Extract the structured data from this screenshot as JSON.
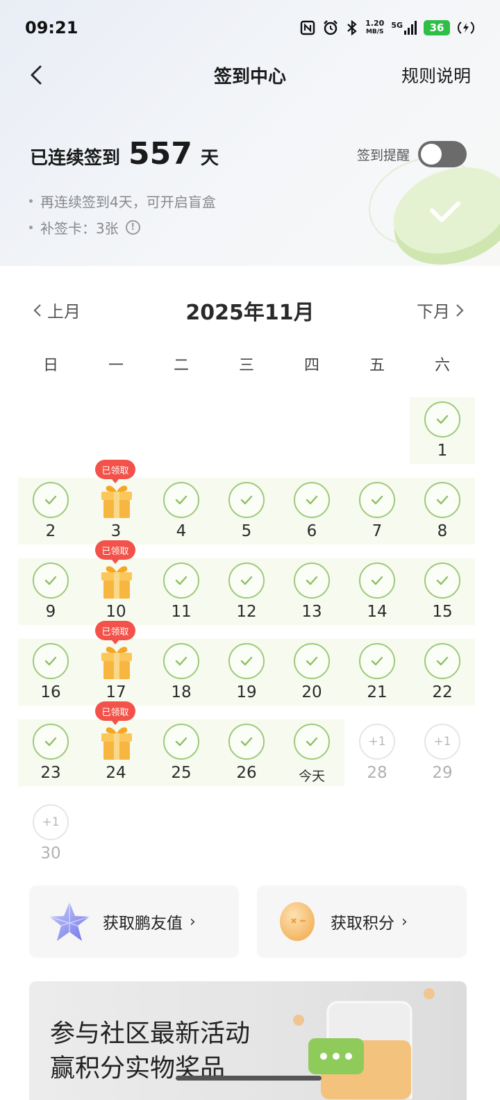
{
  "status_bar": {
    "time": "09:21",
    "net_speed_value": "1.20",
    "net_speed_unit": "MB/S",
    "network_type": "5G",
    "battery": "36"
  },
  "nav": {
    "title": "签到中心",
    "rules_label": "规则说明"
  },
  "streak": {
    "prefix": "已连续签到",
    "days": "557",
    "suffix": "天"
  },
  "reminder": {
    "label": "签到提醒",
    "enabled": false
  },
  "tips": [
    "再连续签到4天，可开启盲盒",
    "补签卡：3张"
  ],
  "calendar": {
    "prev_label": "上月",
    "next_label": "下月",
    "month_title": "2025年11月",
    "weekdays": [
      "日",
      "一",
      "二",
      "三",
      "四",
      "五",
      "六"
    ],
    "claimed_badge": "已领取",
    "days": [
      {
        "label": "1",
        "state": "checked",
        "col": 6,
        "row": 0
      },
      {
        "label": "2",
        "state": "checked",
        "col": 0,
        "row": 1
      },
      {
        "label": "3",
        "state": "gift",
        "col": 1,
        "row": 1
      },
      {
        "label": "4",
        "state": "checked",
        "col": 2,
        "row": 1
      },
      {
        "label": "5",
        "state": "checked",
        "col": 3,
        "row": 1
      },
      {
        "label": "6",
        "state": "checked",
        "col": 4,
        "row": 1
      },
      {
        "label": "7",
        "state": "checked",
        "col": 5,
        "row": 1
      },
      {
        "label": "8",
        "state": "checked",
        "col": 6,
        "row": 1
      },
      {
        "label": "9",
        "state": "checked",
        "col": 0,
        "row": 2
      },
      {
        "label": "10",
        "state": "gift",
        "col": 1,
        "row": 2
      },
      {
        "label": "11",
        "state": "checked",
        "col": 2,
        "row": 2
      },
      {
        "label": "12",
        "state": "checked",
        "col": 3,
        "row": 2
      },
      {
        "label": "13",
        "state": "checked",
        "col": 4,
        "row": 2
      },
      {
        "label": "14",
        "state": "checked",
        "col": 5,
        "row": 2
      },
      {
        "label": "15",
        "state": "checked",
        "col": 6,
        "row": 2
      },
      {
        "label": "16",
        "state": "checked",
        "col": 0,
        "row": 3
      },
      {
        "label": "17",
        "state": "gift",
        "col": 1,
        "row": 3
      },
      {
        "label": "18",
        "state": "checked",
        "col": 2,
        "row": 3
      },
      {
        "label": "19",
        "state": "checked",
        "col": 3,
        "row": 3
      },
      {
        "label": "20",
        "state": "checked",
        "col": 4,
        "row": 3
      },
      {
        "label": "21",
        "state": "checked",
        "col": 5,
        "row": 3
      },
      {
        "label": "22",
        "state": "checked",
        "col": 6,
        "row": 3
      },
      {
        "label": "23",
        "state": "checked",
        "col": 0,
        "row": 4
      },
      {
        "label": "24",
        "state": "gift",
        "col": 1,
        "row": 4
      },
      {
        "label": "25",
        "state": "checked",
        "col": 2,
        "row": 4
      },
      {
        "label": "26",
        "state": "checked",
        "col": 3,
        "row": 4
      },
      {
        "label": "今天",
        "state": "today",
        "col": 4,
        "row": 4
      },
      {
        "label": "28",
        "state": "future",
        "reward": "+1",
        "col": 5,
        "row": 4
      },
      {
        "label": "29",
        "state": "future",
        "reward": "+1",
        "col": 6,
        "row": 4
      },
      {
        "label": "30",
        "state": "future",
        "reward": "+1",
        "col": 0,
        "row": 5
      }
    ],
    "highlight_rows": [
      {
        "row": 0,
        "from_col": 6,
        "to_col": 6
      },
      {
        "row": 1,
        "from_col": 0,
        "to_col": 6
      },
      {
        "row": 2,
        "from_col": 0,
        "to_col": 6
      },
      {
        "row": 3,
        "from_col": 0,
        "to_col": 6
      },
      {
        "row": 4,
        "from_col": 0,
        "to_col": 4
      }
    ]
  },
  "cards": {
    "friend_value_label": "获取鹏友值",
    "points_label": "获取积分"
  },
  "banner": {
    "line1": "参与社区最新活动",
    "line2": "赢积分实物奖品"
  },
  "colors": {
    "check_green": "#9ec978",
    "row_highlight": "#f6faef",
    "badge_red": "#f2524a",
    "gift_orange": "#f7b640",
    "battery_green": "#2fbf47"
  }
}
